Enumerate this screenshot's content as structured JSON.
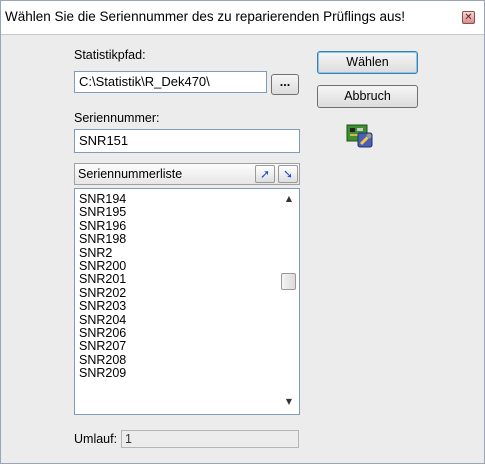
{
  "dialog": {
    "title": "Wählen Sie die Seriennummer des zu reparierenden Prüflings aus!",
    "close_glyph": "✕"
  },
  "statistik": {
    "label": "Statistikpfad:",
    "value": "C:\\Statistik\\R_Dek470\\",
    "browse_label": "..."
  },
  "seriennummer": {
    "label": "Seriennummer:",
    "value": "SNR151"
  },
  "buttons": {
    "select_label": "Wählen",
    "cancel_label": "Abbruch"
  },
  "list": {
    "header": "Seriennummerliste",
    "items": [
      "SNR194",
      "SNR195",
      "SNR196",
      "SNR198",
      "SNR2",
      "SNR200",
      "SNR201",
      "SNR202",
      "SNR203",
      "SNR204",
      "SNR206",
      "SNR207",
      "SNR208",
      "SNR209"
    ]
  },
  "umlauf": {
    "label": "Umlauf:",
    "value": "1"
  },
  "icons": {
    "sort_up": "arrow-up-icon",
    "sort_down": "arrow-down-icon",
    "repair": "repair-board-icon",
    "scroll_up": "scroll-up-icon",
    "scroll_down": "scroll-down-icon"
  },
  "colors": {
    "field_border": "#7f9db9",
    "default_button_border": "#3c7fb1",
    "close_button": "#d88c8c"
  }
}
